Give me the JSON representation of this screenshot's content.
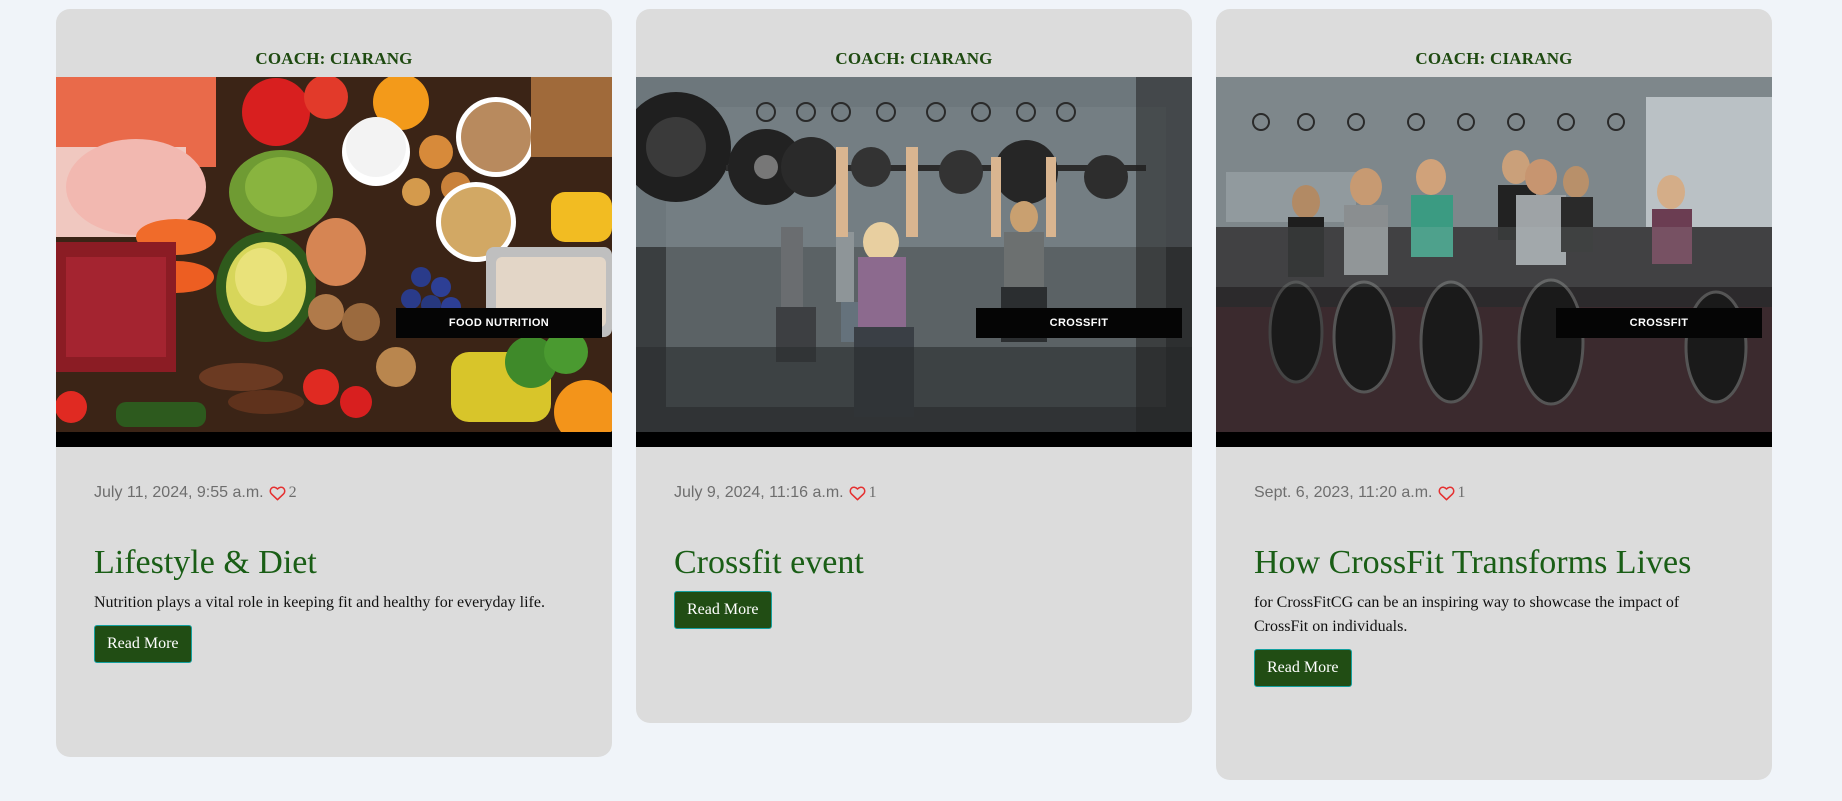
{
  "cards": [
    {
      "coach": "COACH: CIARANG",
      "image_tag": "FOOD NUTRITION",
      "date": "July 11, 2024, 9:55 a.m.",
      "likes": "2",
      "title": "Lifestyle & Diet",
      "excerpt": "Nutrition plays a vital role in keeping fit and healthy for everyday life.",
      "button": "Read More"
    },
    {
      "coach": "COACH: CIARANG",
      "image_tag": "CROSSFIT",
      "date": "July 9, 2024, 11:16 a.m.",
      "likes": "1",
      "title": "Crossfit event",
      "excerpt": "",
      "button": "Read More"
    },
    {
      "coach": "COACH: CIARANG",
      "image_tag": "CROSSFIT",
      "date": "Sept. 6, 2023, 11:20 a.m.",
      "likes": "1",
      "title": "How CrossFit Transforms Lives",
      "excerpt": "for CrossFitCG can be an inspiring way to showcase the impact of CrossFit on individuals.",
      "button": "Read More"
    }
  ],
  "colors": {
    "page_bg": "#f0f4f9",
    "card_bg": "#dcdcdc",
    "title": "#1a5e16",
    "button_bg": "#214d14",
    "heart": "#e53030"
  },
  "icons": {
    "like": "heart-outline-icon"
  }
}
